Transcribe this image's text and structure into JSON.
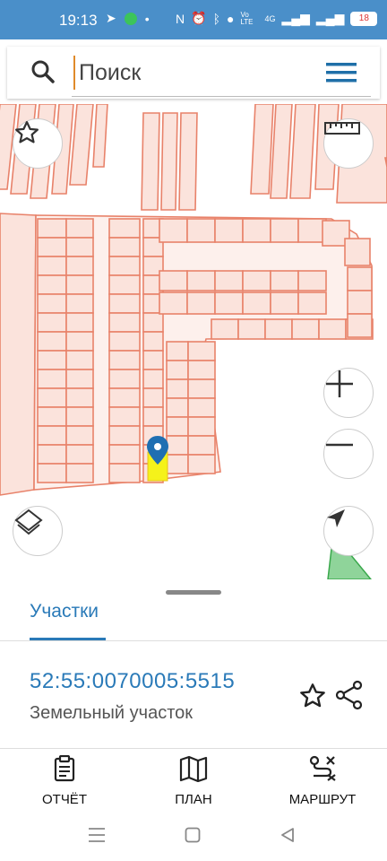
{
  "status_bar": {
    "time": "19:13",
    "network": "4G",
    "volte": "Vo LTE",
    "battery": "18"
  },
  "search": {
    "placeholder": "Поиск"
  },
  "map": {
    "parcel_fill": "#fbe3dc",
    "parcel_stroke": "#e8826a",
    "selected_fill": "#f5f21a",
    "marker_color": "#1f6fb2"
  },
  "sheet": {
    "tab_label": "Участки",
    "parcel_id": "52:55:0070005:5515",
    "parcel_type": "Земельный участок"
  },
  "actions": [
    {
      "label": "ОТЧЁТ",
      "icon": "clipboard-icon"
    },
    {
      "label": "ПЛАН",
      "icon": "map-icon"
    },
    {
      "label": "МАРШРУТ",
      "icon": "route-icon"
    }
  ],
  "accent": "#2a7ab8"
}
